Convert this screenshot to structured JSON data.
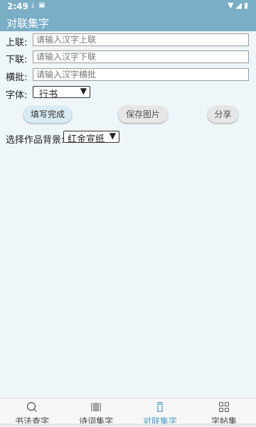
{
  "status_bar": {
    "time": "2:49",
    "icons": [
      "download-icon",
      "notification-icon",
      "wifi-icon",
      "signal-icon",
      "battery-icon"
    ]
  },
  "app_bar": {
    "title": "对联集字"
  },
  "form": {
    "upper_label": "上联:",
    "upper_placeholder": "请输入汉字上联",
    "lower_label": "下联:",
    "lower_placeholder": "请输入汉字下联",
    "horizontal_label": "横批:",
    "horizontal_placeholder": "请输入汉字横批",
    "font_label": "字体:",
    "font_value": "行书"
  },
  "buttons": {
    "fill": "填写完成",
    "save": "保存图片",
    "share": "分享"
  },
  "background": {
    "label": "选择作品背景:",
    "value": "红金宣纸"
  },
  "bottom_nav": {
    "items": [
      {
        "label": "书法查字",
        "icon": "search-icon",
        "active": false
      },
      {
        "label": "诗词集字",
        "icon": "barcode-icon",
        "active": false
      },
      {
        "label": "对联集字",
        "icon": "couplet-icon",
        "active": true
      },
      {
        "label": "字帖集",
        "icon": "grid-icon",
        "active": false
      }
    ]
  },
  "colors": {
    "header": "#7aaec6",
    "background": "#eef6f9",
    "active_nav": "#4a9ec9"
  }
}
